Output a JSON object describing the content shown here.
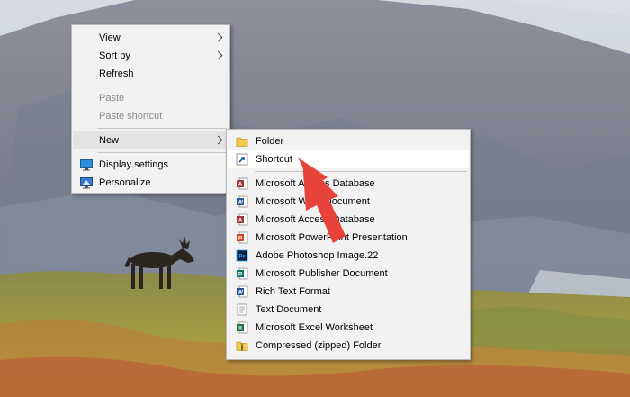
{
  "context_menu": {
    "items": [
      {
        "label": "View"
      },
      {
        "label": "Sort by"
      },
      {
        "label": "Refresh"
      },
      {
        "label": "Paste"
      },
      {
        "label": "Paste shortcut"
      },
      {
        "label": "New"
      },
      {
        "label": "Display settings"
      },
      {
        "label": "Personalize"
      }
    ]
  },
  "new_submenu": {
    "items": [
      {
        "label": "Folder"
      },
      {
        "label": "Shortcut"
      },
      {
        "label": "Microsoft Access Database"
      },
      {
        "label": "Microsoft Word Document"
      },
      {
        "label": "Microsoft Access Database"
      },
      {
        "label": "Microsoft PowerPoint Presentation"
      },
      {
        "label": "Adobe Photoshop Image.22"
      },
      {
        "label": "Microsoft Publisher Document"
      },
      {
        "label": "Rich Text Format"
      },
      {
        "label": "Text Document"
      },
      {
        "label": "Microsoft Excel Worksheet"
      },
      {
        "label": "Compressed (zipped) Folder"
      }
    ]
  },
  "colors": {
    "arrow": "#e8433a",
    "menu_bg": "#f2f2f2",
    "disabled_text": "#8a8a8a"
  }
}
